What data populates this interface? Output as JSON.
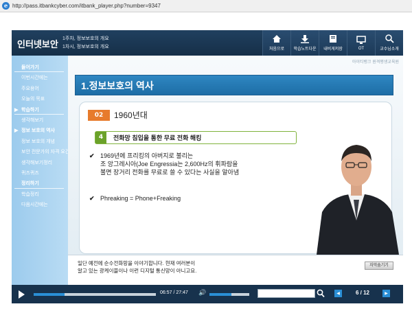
{
  "browser": {
    "url": "http://pass.itbankcyber.com/itbank_player.php?number=9347"
  },
  "header": {
    "brand": "인터넷보안",
    "lesson_line1": "1주차, 정보보호의 개요",
    "lesson_line2": "1차시, 정보보호의 개요",
    "buttons": [
      {
        "label": "처음으로",
        "icon": "home-icon"
      },
      {
        "label": "학습노트다운",
        "icon": "download-icon"
      },
      {
        "label": "내비게저장",
        "icon": "book-icon"
      },
      {
        "label": "OT",
        "icon": "monitor-icon"
      },
      {
        "label": "교수님소개",
        "icon": "professor-icon"
      }
    ]
  },
  "sidebar": {
    "items": [
      {
        "label": "들어가기",
        "head": true
      },
      {
        "label": "이번시간에는"
      },
      {
        "label": "주요용어"
      },
      {
        "label": "오늘의 목표"
      },
      {
        "label": "학습하기",
        "head": true,
        "active": true
      },
      {
        "label": "생각해보기"
      },
      {
        "label": "정보 보호의 역사",
        "active": true
      },
      {
        "label": "정보 보호의 개념"
      },
      {
        "label": "보안 전문가의 자격 요건"
      },
      {
        "label": "생각해보기정리"
      },
      {
        "label": "퀴즈퀴즈"
      },
      {
        "label": "정리하기",
        "head": true
      },
      {
        "label": "학습정리"
      },
      {
        "label": "다음시간에는"
      }
    ]
  },
  "slide": {
    "logo": "아이티뱅크 원격평생교육원",
    "title": "1.정보보호의 역사",
    "year_badge": "02",
    "year_label": "1960년대",
    "section_num": "4",
    "section_title": "전화망 침입을 통한 무료 전화 해킹",
    "bullet1": [
      "1969년에 프리킹의 아버지로 불리는",
      "조 앙그레시아(Joe Engressia는 2,600Hz의 휘파람을",
      "불면 장거리 전화를 무료로 쓸 수 있다는 사실을 알아냄"
    ],
    "bullet2": "Phreaking = Phone+Freaking",
    "check": "✔"
  },
  "caption": {
    "line1": "일단 예전에 순수전화망을 이야기합니다. 현재 여러분이",
    "line2": "알고 있는 광케이블이나 이런 디지털 통신망이 아니고요.",
    "button": "자막숨기기"
  },
  "player": {
    "time": "06:57 / 27:47",
    "progress": 0.25,
    "volume": 0.55,
    "page": "6 / 12",
    "search_value": ""
  },
  "colors": {
    "frame": "#17324d",
    "accent": "#2a8fd6",
    "sidebar": "#a8d3f0",
    "badge": "#e77b2c",
    "section": "#6ba22a"
  }
}
